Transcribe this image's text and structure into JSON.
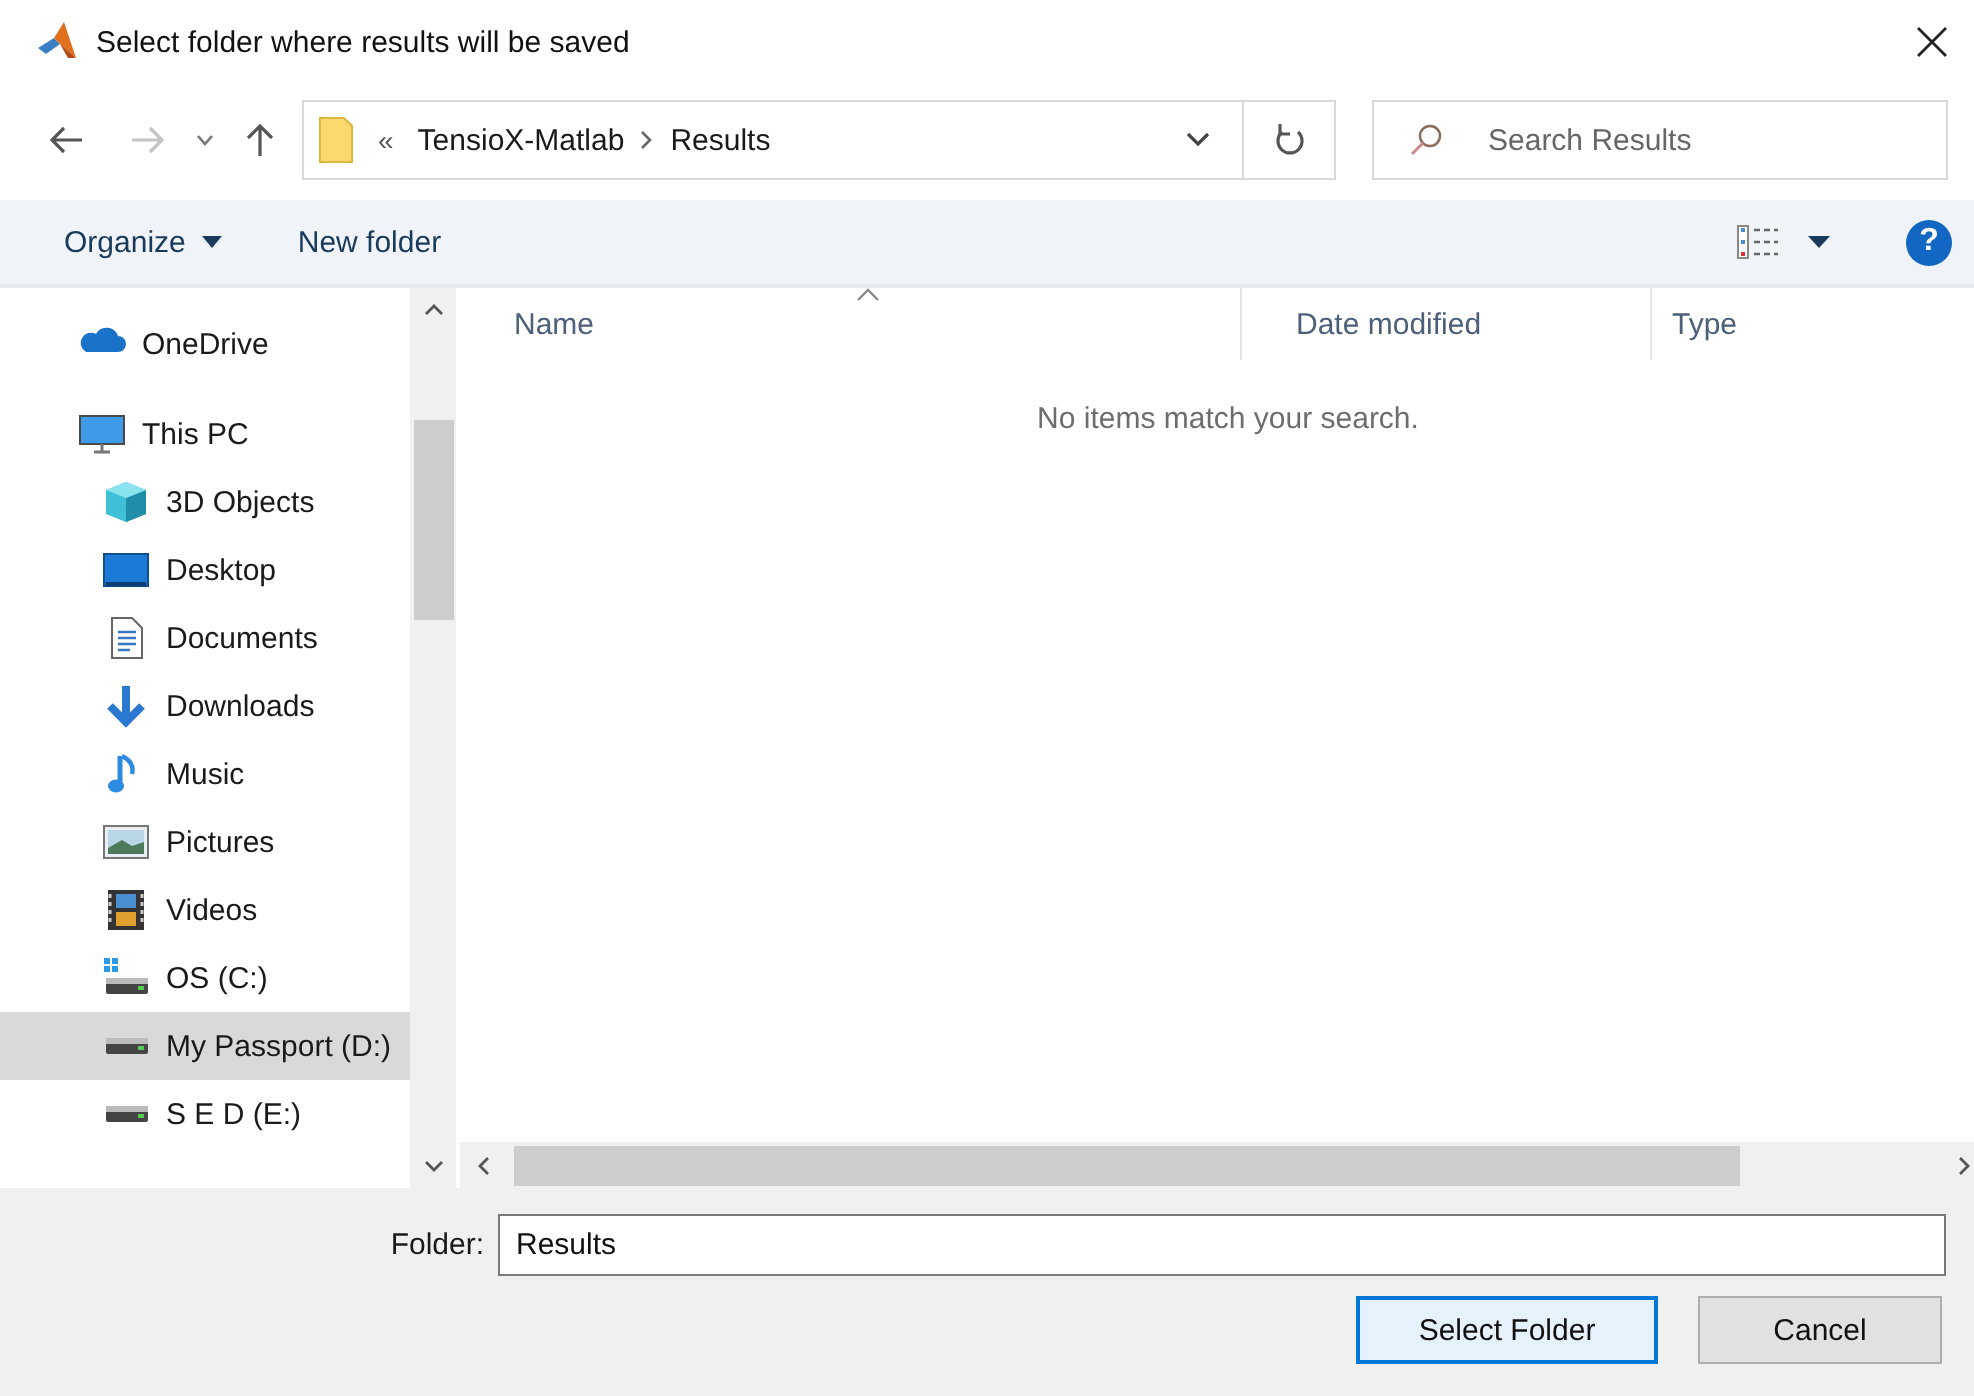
{
  "window": {
    "title": "Select folder where results will be saved"
  },
  "address_bar": {
    "overflow": "«",
    "path": [
      {
        "label": "TensioX-Matlab"
      },
      {
        "label": "Results"
      }
    ]
  },
  "search": {
    "placeholder": "Search Results"
  },
  "toolbar": {
    "items": [
      {
        "label": "Organize",
        "dropdown": true
      },
      {
        "label": "New folder",
        "dropdown": false
      }
    ],
    "help": "?"
  },
  "nav_pane": {
    "items": [
      {
        "label": "OneDrive",
        "kind": "cloud",
        "selected": false
      },
      {
        "label": "This PC",
        "kind": "pc",
        "selected": false,
        "children": [
          {
            "label": "3D Objects",
            "kind": "cube",
            "selected": false
          },
          {
            "label": "Desktop",
            "kind": "desktop",
            "selected": false
          },
          {
            "label": "Documents",
            "kind": "document",
            "selected": false
          },
          {
            "label": "Downloads",
            "kind": "download",
            "selected": false
          },
          {
            "label": "Music",
            "kind": "music",
            "selected": false
          },
          {
            "label": "Pictures",
            "kind": "pictures",
            "selected": false
          },
          {
            "label": "Videos",
            "kind": "video",
            "selected": false
          },
          {
            "label": "OS (C:)",
            "kind": "system-drive",
            "selected": false
          },
          {
            "label": "My Passport (D:)",
            "kind": "drive",
            "selected": true
          },
          {
            "label": "S E D (E:)",
            "kind": "drive",
            "selected": false
          }
        ]
      }
    ]
  },
  "file_list": {
    "columns": [
      {
        "label": "Name",
        "sorted": true
      },
      {
        "label": "Date modified",
        "sorted": false
      },
      {
        "label": "Type",
        "sorted": false
      }
    ],
    "empty_message": "No items match your search."
  },
  "footer": {
    "folder_label": "Folder:",
    "folder_value": "Results",
    "buttons": [
      {
        "label": "Select Folder",
        "default": true
      },
      {
        "label": "Cancel",
        "default": false
      }
    ]
  }
}
